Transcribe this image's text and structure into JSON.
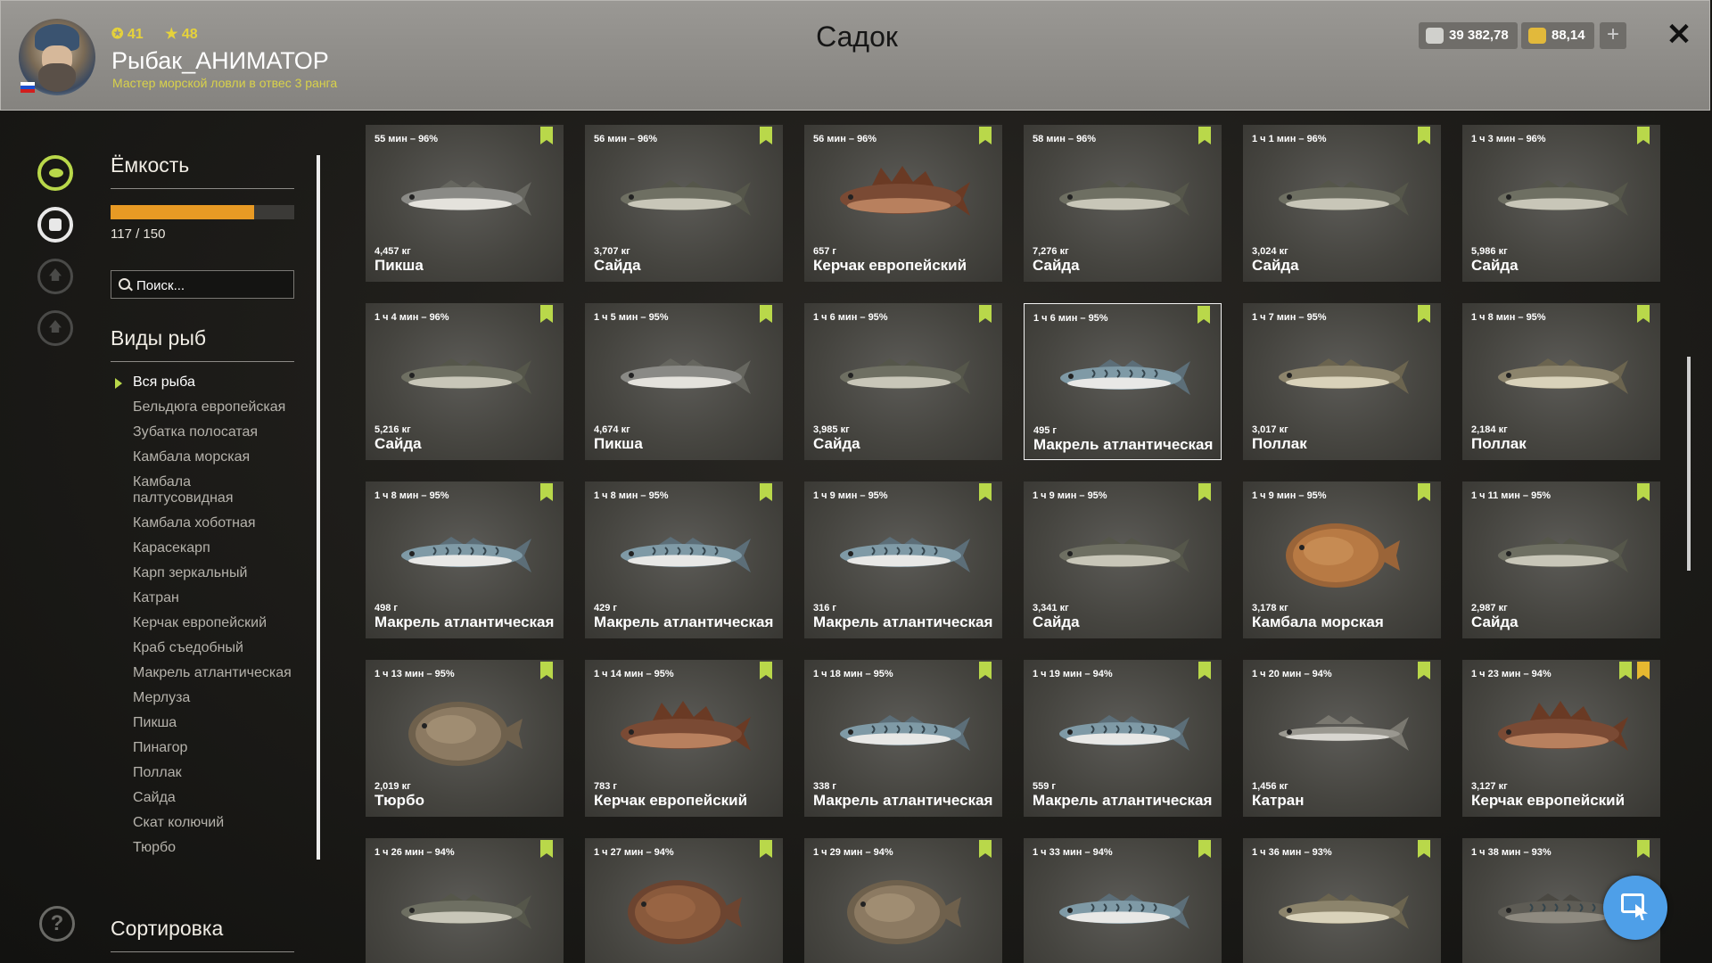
{
  "header": {
    "title": "Садок",
    "player": {
      "name": "Рыбак_АНИМАТОР",
      "level": "41",
      "stars": "48",
      "rank": "Мастер морской ловли в отвес 3 ранга",
      "flag": "russia-flag"
    },
    "currency": {
      "silver": "39 382,78",
      "gold": "88,14",
      "silver_icon": "coins-silver-icon",
      "gold_icon": "coins-gold-icon",
      "add_label": "+"
    },
    "close_label": "✕"
  },
  "sidebar": {
    "nav": [
      {
        "name": "fish-icon",
        "active": true
      },
      {
        "name": "keepnet-icon",
        "active": false
      },
      {
        "name": "upgrade-icon",
        "active": false
      },
      {
        "name": "home-icon",
        "active": false
      }
    ],
    "help_label": "?"
  },
  "filters": {
    "capacity_heading": "Ёмкость",
    "capacity": {
      "used": 117,
      "total": 150,
      "text": "117 / 150"
    },
    "search_placeholder": "Поиск...",
    "species_heading": "Виды рыб",
    "species": [
      "Вся рыба",
      "Бельдюга европейская",
      "Зубатка полосатая",
      "Камбала морская",
      "Камбала палтусовидная",
      "Камбала хоботная",
      "Карасекарп",
      "Карп зеркальный",
      "Катран",
      "Керчак европейский",
      "Краб съедобный",
      "Макрель атлантическая",
      "Мерлуза",
      "Пикша",
      "Пинагор",
      "Поллак",
      "Сайда",
      "Скат колючий",
      "Тюрбо"
    ],
    "selected_species": "Вся рыба",
    "sort_heading": "Сортировка"
  },
  "catches": [
    {
      "time": "55 мин – 96%",
      "weight": "4,457 кг",
      "name": "Пикша",
      "kind": "haddock"
    },
    {
      "time": "56 мин – 96%",
      "weight": "3,707 кг",
      "name": "Сайда",
      "kind": "pollock"
    },
    {
      "time": "56 мин – 96%",
      "weight": "657 г",
      "name": "Керчак европейский",
      "kind": "sculpin"
    },
    {
      "time": "58 мин – 96%",
      "weight": "7,276 кг",
      "name": "Сайда",
      "kind": "pollock"
    },
    {
      "time": "1 ч 1 мин – 96%",
      "weight": "3,024 кг",
      "name": "Сайда",
      "kind": "pollock"
    },
    {
      "time": "1 ч 3 мин – 96%",
      "weight": "5,986 кг",
      "name": "Сайда",
      "kind": "pollock"
    },
    {
      "time": "1 ч 4 мин – 96%",
      "weight": "5,216 кг",
      "name": "Сайда",
      "kind": "pollock"
    },
    {
      "time": "1 ч 5 мин – 95%",
      "weight": "4,674 кг",
      "name": "Пикша",
      "kind": "haddock"
    },
    {
      "time": "1 ч 6 мин – 95%",
      "weight": "3,985 кг",
      "name": "Сайда",
      "kind": "pollock"
    },
    {
      "time": "1 ч 6 мин – 95%",
      "weight": "495 г",
      "name": "Макрель атлантическая",
      "kind": "mackerel",
      "selected": true
    },
    {
      "time": "1 ч 7 мин – 95%",
      "weight": "3,017 кг",
      "name": "Поллак",
      "kind": "pollack"
    },
    {
      "time": "1 ч 8 мин – 95%",
      "weight": "2,184 кг",
      "name": "Поллак",
      "kind": "pollack"
    },
    {
      "time": "1 ч 8 мин – 95%",
      "weight": "498 г",
      "name": "Макрель атлантическая",
      "kind": "mackerel"
    },
    {
      "time": "1 ч 8 мин – 95%",
      "weight": "429 г",
      "name": "Макрель атлантическая",
      "kind": "mackerel"
    },
    {
      "time": "1 ч 9 мин – 95%",
      "weight": "316 г",
      "name": "Макрель атлантическая",
      "kind": "mackerel"
    },
    {
      "time": "1 ч 9 мин – 95%",
      "weight": "3,341 кг",
      "name": "Сайда",
      "kind": "pollock"
    },
    {
      "time": "1 ч 9 мин – 95%",
      "weight": "3,178 кг",
      "name": "Камбала морская",
      "kind": "plaice"
    },
    {
      "time": "1 ч 11 мин – 95%",
      "weight": "2,987 кг",
      "name": "Сайда",
      "kind": "pollock"
    },
    {
      "time": "1 ч 13 мин – 95%",
      "weight": "2,019 кг",
      "name": "Тюрбо",
      "kind": "turbot"
    },
    {
      "time": "1 ч 14 мин – 95%",
      "weight": "783 г",
      "name": "Керчак европейский",
      "kind": "sculpin"
    },
    {
      "time": "1 ч 18 мин – 95%",
      "weight": "338 г",
      "name": "Макрель атлантическая",
      "kind": "mackerel"
    },
    {
      "time": "1 ч 19 мин – 94%",
      "weight": "559 г",
      "name": "Макрель атлантическая",
      "kind": "mackerel"
    },
    {
      "time": "1 ч 20 мин – 94%",
      "weight": "1,456 кг",
      "name": "Катран",
      "kind": "dogfish"
    },
    {
      "time": "1 ч 23 мин – 94%",
      "weight": "3,127 кг",
      "name": "Керчак европейский",
      "kind": "sculpin",
      "star": true
    },
    {
      "time": "1 ч 26 мин – 94%",
      "weight": "",
      "name": "",
      "kind": "pollock"
    },
    {
      "time": "1 ч 27 мин – 94%",
      "weight": "",
      "name": "",
      "kind": "flounder"
    },
    {
      "time": "1 ч 29 мин – 94%",
      "weight": "",
      "name": "",
      "kind": "turbot"
    },
    {
      "time": "1 ч 33 мин – 94%",
      "weight": "",
      "name": "",
      "kind": "mackerel"
    },
    {
      "time": "1 ч 36 мин – 93%",
      "weight": "",
      "name": "",
      "kind": "pollack"
    },
    {
      "time": "1 ч 38 мин – 93%",
      "weight": "",
      "name": "",
      "kind": "wolffish"
    }
  ],
  "colors": {
    "accent": "#b9d84a",
    "capacity_bar": "#e89a24",
    "fab": "#4e9fe8"
  },
  "fab_icon": "cursor-select-icon"
}
